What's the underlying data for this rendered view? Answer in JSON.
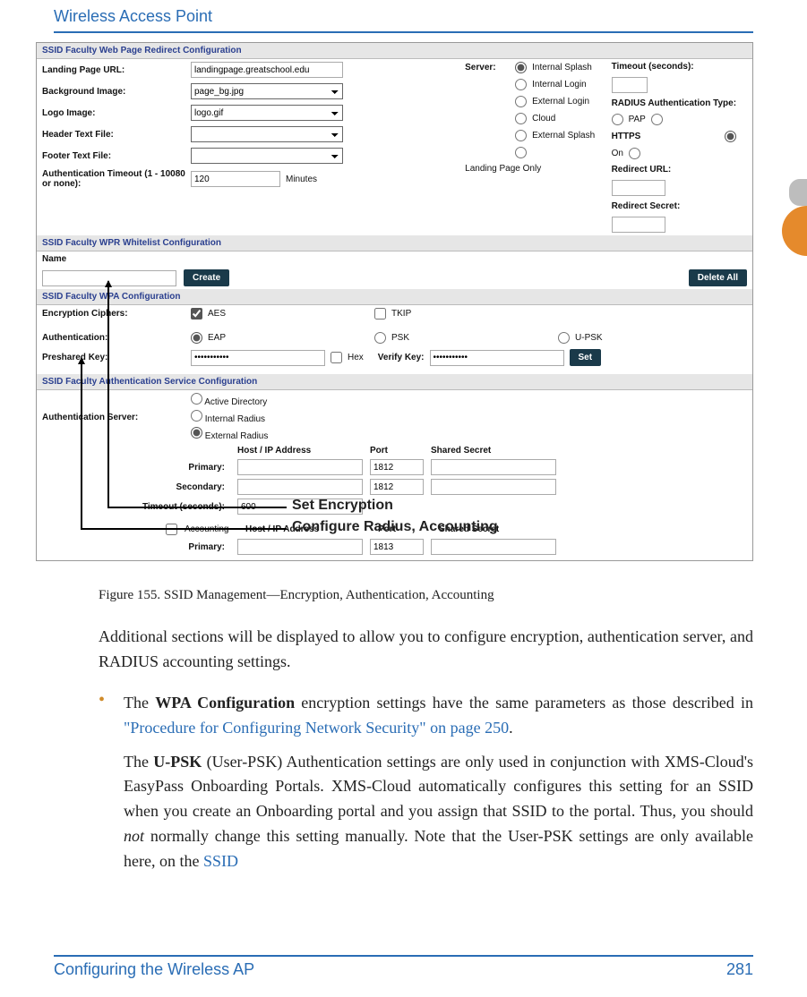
{
  "header": {
    "running_head": "Wireless Access Point"
  },
  "shot": {
    "s1_title": "SSID Faculty   Web Page Redirect Configuration",
    "landing_lbl": "Landing Page URL:",
    "landing_val": "landingpage.greatschool.edu",
    "bg_lbl": "Background Image:",
    "bg_val": "page_bg.jpg",
    "logo_lbl": "Logo Image:",
    "logo_val": "logo.gif",
    "hdr_lbl": "Header Text File:",
    "ftr_lbl": "Footer Text File:",
    "authto_lbl": "Authentication Timeout  (1 - 10080 or none):",
    "authto_val": "120",
    "authto_unit": "Minutes",
    "server_lbl": "Server:",
    "srv_int_splash": "Internal Splash",
    "srv_int_login": "Internal Login",
    "srv_ext_login": "External Login",
    "srv_cloud": "Cloud",
    "srv_ext_splash": "External Splash",
    "srv_landing": "Landing Page Only",
    "timeout_lbl": "Timeout (seconds):",
    "radius_type_lbl": "RADIUS Authentication Type:",
    "radius_pap": "PAP",
    "https_lbl": "HTTPS",
    "https_on": "On",
    "redirect_url_lbl": "Redirect URL:",
    "redirect_secret_lbl": "Redirect Secret:",
    "s2_title": "SSID Faculty   WPR Whitelist Configuration",
    "name_lbl": "Name",
    "create_btn": "Create",
    "delete_btn": "Delete All",
    "s3_title": "SSID Faculty   WPA Configuration",
    "enc_lbl": "Encryption Ciphers:",
    "aes": "AES",
    "tkip": "TKIP",
    "auth_lbl": "Authentication:",
    "eap": "EAP",
    "psk": "PSK",
    "upsk": "U-PSK",
    "prekey_lbl": "Preshared Key:",
    "prekey_val": "•••••••••••",
    "hex": "Hex",
    "verify_lbl": "Verify Key:",
    "verify_val": "•••••••••••",
    "set_btn": "Set",
    "s4_title": "SSID Faculty   Authentication Service Configuration",
    "authsrv_lbl": "Authentication Server:",
    "ad": "Active Directory",
    "ir": "Internal Radius",
    "er": "External Radius",
    "host_hdr": "Host / IP Address",
    "port_hdr": "Port",
    "secret_hdr": "Shared Secret",
    "primary": "Primary:",
    "secondary": "Secondary:",
    "timeout_lbl2": "Timeout (seconds):",
    "timeout_val": "600",
    "port_1812": "1812",
    "accounting": "Accounting",
    "acct_port": "1813"
  },
  "callouts": {
    "set_enc": "Set Encryption",
    "conf_radius": "Configure Radius, Accounting"
  },
  "caption": "Figure 155. SSID Management—Encryption, Authentication, Accounting",
  "body": {
    "p1": "Additional sections will be displayed to allow you to configure encryption, authentication server, and RADIUS accounting settings.",
    "b1a": "The ",
    "b1b": "WPA Configuration",
    "b1c": " encryption settings have the same parameters as those described in ",
    "b1d": "\"Procedure for Configuring Network Security\" on page 250",
    "b1e": ".",
    "b2a": "The ",
    "b2b": "U-PSK",
    "b2c": " (User-PSK) Authentication settings are only used in conjunction with XMS-Cloud's EasyPass Onboarding Portals. XMS-Cloud automatically configures this setting for an SSID when you create an Onboarding portal and you assign that SSID to the portal. Thus, you should ",
    "b2d": "not",
    "b2e": " normally change this setting manually. Note that the User-PSK settings are only available here, on the ",
    "b2f": "SSID"
  },
  "footer": {
    "left": "Configuring the Wireless AP",
    "right": "281"
  }
}
